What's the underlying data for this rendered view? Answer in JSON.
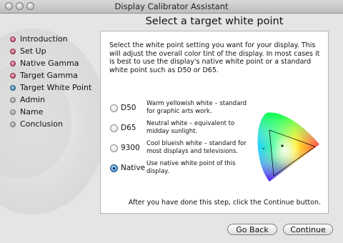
{
  "window": {
    "title": "Display Calibrator Assistant"
  },
  "page": {
    "heading": "Select a target white point"
  },
  "steps": [
    {
      "label": "Introduction",
      "state": "done"
    },
    {
      "label": "Set Up",
      "state": "done"
    },
    {
      "label": "Native Gamma",
      "state": "done"
    },
    {
      "label": "Target Gamma",
      "state": "done"
    },
    {
      "label": "Target White Point",
      "state": "current"
    },
    {
      "label": "Admin",
      "state": "todo"
    },
    {
      "label": "Name",
      "state": "todo"
    },
    {
      "label": "Conclusion",
      "state": "todo"
    }
  ],
  "panel": {
    "intro": "Select the white point setting you want for your display.  This will adjust the overall color tint of the display.  In most cases it is best to use the display's native white point or a standard white point such as D50 or D65.",
    "options": [
      {
        "label": "D50",
        "desc": "Warm yellowish white – standard for graphic arts work.",
        "selected": false
      },
      {
        "label": "D65",
        "desc": "Neutral white – equivalent to midday sunlight.",
        "selected": false
      },
      {
        "label": "9300",
        "desc": "Cool blueish white – standard for most displays and televisions.",
        "selected": false
      },
      {
        "label": "Native",
        "desc": "Use native white point of this display.",
        "selected": true
      }
    ],
    "footer": "After you have done this step, click the Continue button."
  },
  "buttons": {
    "back": "Go Back",
    "continue": "Continue"
  }
}
